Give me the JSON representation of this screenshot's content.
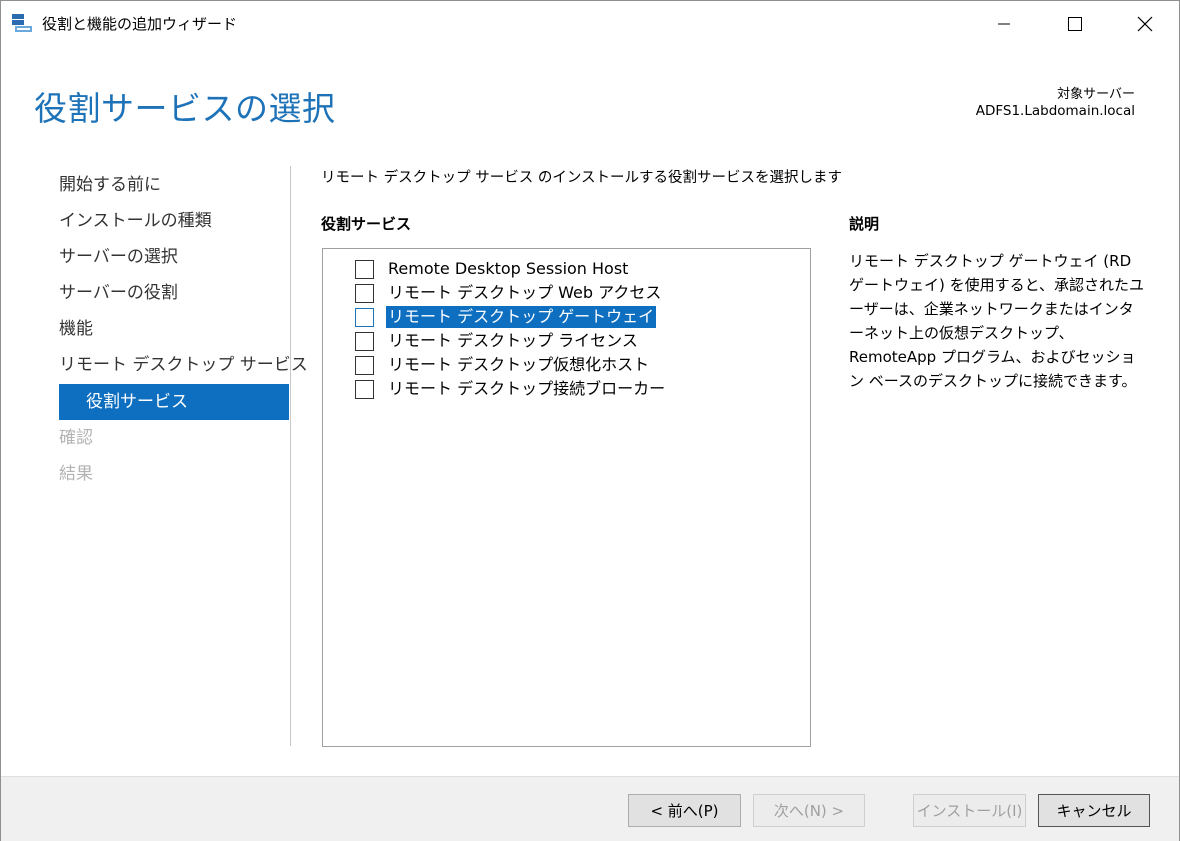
{
  "window": {
    "title": "役割と機能の追加ウィザード"
  },
  "header": {
    "page_title": "役割サービスの選択",
    "target_label": "対象サーバー",
    "target_server": "ADFS1.Labdomain.local"
  },
  "nav": {
    "items": [
      {
        "label": "開始する前に",
        "state": "normal"
      },
      {
        "label": "インストールの種類",
        "state": "normal"
      },
      {
        "label": "サーバーの選択",
        "state": "normal"
      },
      {
        "label": "サーバーの役割",
        "state": "normal"
      },
      {
        "label": "機能",
        "state": "normal"
      },
      {
        "label": "リモート デスクトップ サービス",
        "state": "normal"
      },
      {
        "label": "役割サービス",
        "state": "active"
      },
      {
        "label": "確認",
        "state": "disabled"
      },
      {
        "label": "結果",
        "state": "disabled"
      }
    ]
  },
  "main": {
    "instruction": "リモート デスクトップ サービス のインストールする役割サービスを選択します",
    "roles_heading": "役割サービス",
    "roles": [
      {
        "label": "Remote Desktop Session Host",
        "checked": false,
        "selected": false
      },
      {
        "label": "リモート デスクトップ Web アクセス",
        "checked": false,
        "selected": false
      },
      {
        "label": "リモート デスクトップ ゲートウェイ",
        "checked": false,
        "selected": true
      },
      {
        "label": "リモート デスクトップ ライセンス",
        "checked": false,
        "selected": false
      },
      {
        "label": "リモート デスクトップ仮想化ホスト",
        "checked": false,
        "selected": false
      },
      {
        "label": "リモート デスクトップ接続ブローカー",
        "checked": false,
        "selected": false
      }
    ]
  },
  "description": {
    "heading": "説明",
    "text": "リモート デスクトップ ゲートウェイ (RD ゲートウェイ) を使用すると、承認されたユーザーは、企業ネットワークまたはインターネット上の仮想デスクトップ、RemoteApp プログラム、およびセッション ベースのデスクトップに接続できます。"
  },
  "footer": {
    "prev_label": "< 前へ(P)",
    "next_label": "次へ(N) >",
    "install_label": "インストール(I)",
    "cancel_label": "キャンセル"
  },
  "colors": {
    "accent": "#0e6fc1",
    "title_blue": "#1e73b8",
    "disabled_text": "#b3b3b3"
  }
}
